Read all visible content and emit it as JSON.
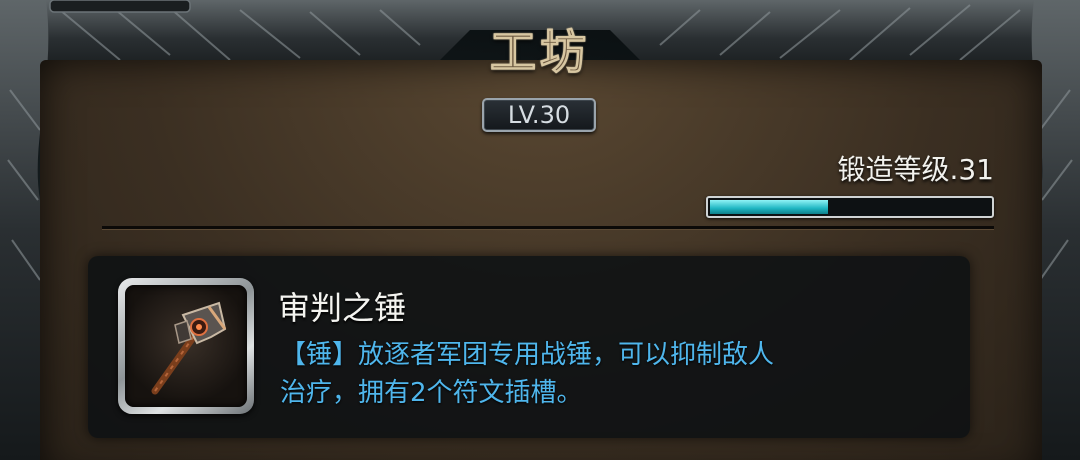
{
  "workshop": {
    "title": "工坊",
    "level_badge": "LV.30"
  },
  "forging": {
    "label": "锻造等级.31",
    "progress_fraction": 0.42,
    "bar_color": "#1fb6c2"
  },
  "item": {
    "name": "审判之锤",
    "icon": "war-hammer-icon",
    "description_lines": [
      "【锤】放逐者军团专用战锤，可以抑制敌人",
      "治疗，拥有2个符文插槽。"
    ],
    "description_color": "#4fb6ec"
  }
}
